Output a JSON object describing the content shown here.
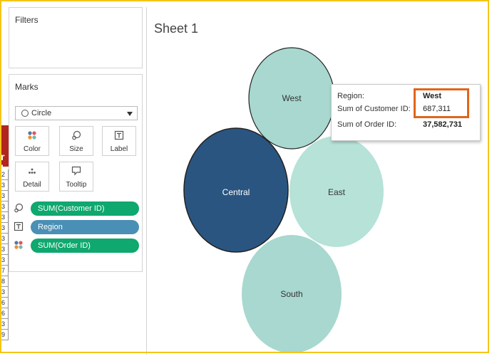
{
  "left_pane": {
    "filters_title": "Filters",
    "marks_title": "Marks",
    "mark_type": "Circle",
    "buttons": [
      {
        "label": "Color",
        "icon": "color-dots-icon"
      },
      {
        "label": "Size",
        "icon": "size-icon"
      },
      {
        "label": "Label",
        "icon": "label-icon"
      },
      {
        "label": "Detail",
        "icon": "detail-icon"
      },
      {
        "label": "Tooltip",
        "icon": "tooltip-icon"
      }
    ],
    "pills": [
      {
        "label": "SUM(Customer ID)",
        "icon": "size-icon",
        "color": "#0fa86e"
      },
      {
        "label": "Region",
        "icon": "label-icon",
        "color": "#4a8fb5"
      },
      {
        "label": "SUM(Order ID)",
        "icon": "color-dots-icon",
        "color": "#0fa86e"
      }
    ]
  },
  "background_sheet": {
    "header": "r I",
    "rows": [
      "2",
      "3",
      "3",
      "3",
      "3",
      "3",
      "3",
      "3",
      "3",
      "7",
      "8",
      "3",
      "6",
      "6",
      "3",
      "9"
    ]
  },
  "sheet": {
    "title": "Sheet 1"
  },
  "bubbles": [
    {
      "label": "West",
      "color": "#a8d8d0",
      "stroke": "#222222"
    },
    {
      "label": "Central",
      "color": "#2b5581",
      "stroke": "#222222"
    },
    {
      "label": "East",
      "color": "#b6e2d8",
      "stroke": "none"
    },
    {
      "label": "South",
      "color": "#a8d8d0",
      "stroke": "none"
    }
  ],
  "tooltip": {
    "rows": [
      {
        "key": "Region:",
        "value": "West"
      },
      {
        "key": "Sum of Customer ID:",
        "value": "687,311"
      },
      {
        "key": "Sum of Order ID:",
        "value": "37,582,731"
      }
    ]
  }
}
